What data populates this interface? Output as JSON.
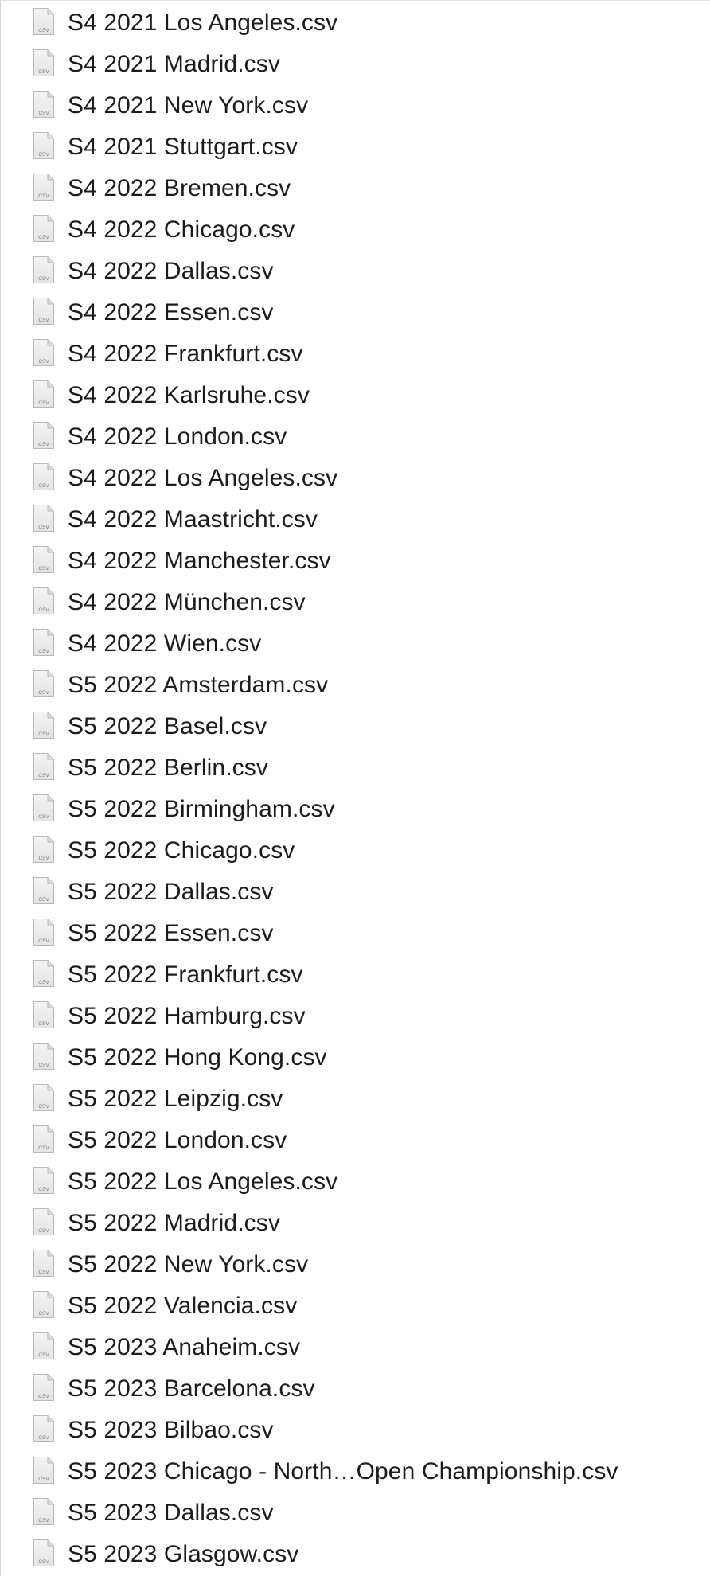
{
  "file_list": {
    "icon": "csv-file-icon",
    "icon_label": "CSV",
    "files": [
      "S4 2021 Los Angeles.csv",
      "S4 2021 Madrid.csv",
      "S4 2021 New York.csv",
      "S4 2021 Stuttgart.csv",
      "S4 2022 Bremen.csv",
      "S4 2022 Chicago.csv",
      "S4 2022 Dallas.csv",
      "S4 2022 Essen.csv",
      "S4 2022 Frankfurt.csv",
      "S4 2022 Karlsruhe.csv",
      "S4 2022 London.csv",
      "S4 2022 Los Angeles.csv",
      "S4 2022 Maastricht.csv",
      "S4 2022 Manchester.csv",
      "S4 2022 München.csv",
      "S4 2022 Wien.csv",
      "S5 2022 Amsterdam.csv",
      "S5 2022 Basel.csv",
      "S5 2022 Berlin.csv",
      "S5 2022 Birmingham.csv",
      "S5 2022 Chicago.csv",
      "S5 2022 Dallas.csv",
      "S5 2022 Essen.csv",
      "S5 2022 Frankfurt.csv",
      "S5 2022 Hamburg.csv",
      "S5 2022 Hong Kong.csv",
      "S5 2022 Leipzig.csv",
      "S5 2022 London.csv",
      "S5 2022 Los Angeles.csv",
      "S5 2022 Madrid.csv",
      "S5 2022 New York.csv",
      "S5 2022 Valencia.csv",
      "S5 2023 Anaheim.csv",
      "S5 2023 Barcelona.csv",
      "S5 2023 Bilbao.csv",
      "S5 2023 Chicago - North…Open Championship.csv",
      "S5 2023 Dallas.csv",
      "S5 2023 Glasgow.csv"
    ]
  }
}
